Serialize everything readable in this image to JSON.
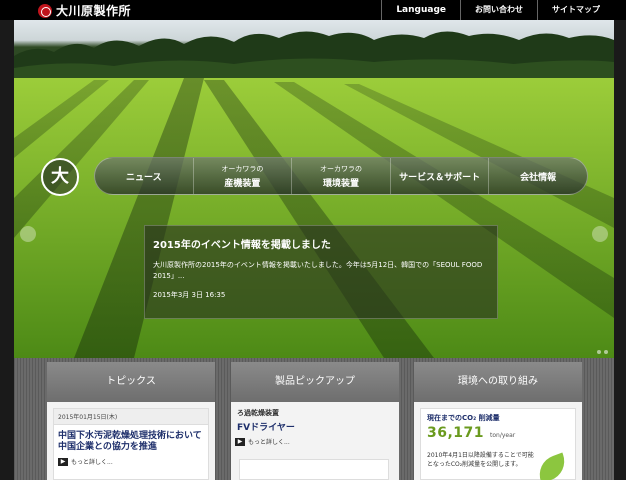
{
  "header": {
    "logo_text": "大川原製作所",
    "nav": [
      {
        "label": "Language"
      },
      {
        "label": "お問い合わせ"
      },
      {
        "label": "サイトマップ"
      }
    ]
  },
  "hero": {
    "emblem_text": "大",
    "main_nav": [
      {
        "label": "ニュース",
        "sub": ""
      },
      {
        "label": "産機装置",
        "sub": "オーカワラの"
      },
      {
        "label": "環境装置",
        "sub": "オーカワラの"
      },
      {
        "label": "サービス＆サポート",
        "sub": ""
      },
      {
        "label": "会社情報",
        "sub": ""
      }
    ],
    "news": {
      "title": "2015年のイベント情報を掲載しました",
      "body": "大川原製作所の2015年のイベント情報を掲載いたしました。今年は5月12日、韓国での「SEOUL FOOD 2015」...",
      "date": "2015年3月 3日 16:35"
    }
  },
  "panels": {
    "topics": {
      "heading": "トピックス",
      "date": "2015年01月15日(木)",
      "title": "中国下水汚泥乾燥処理技術において中国企業との協力を推進",
      "more": "もっと詳しく..."
    },
    "products": {
      "heading": "製品ピックアップ",
      "sub": "ろ過乾燥装置",
      "name": "FVドライヤー",
      "more": "もっと詳しく..."
    },
    "environment": {
      "heading": "環境への取り組み",
      "label": "現在までのCO₂ 削減量",
      "value": "36,171",
      "unit": "ton/year",
      "desc": "2010年4月1日以降設備することで可能となったCO₂削減量を公開します。"
    }
  },
  "colors": {
    "accent_red": "#c0141c",
    "title_navy": "#1e2f6b",
    "value_green": "#6a9a1e"
  }
}
